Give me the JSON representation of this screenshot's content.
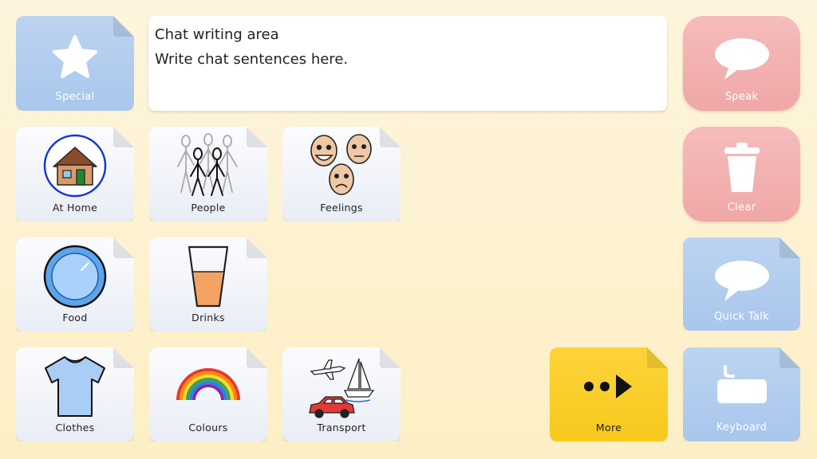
{
  "chat": {
    "line1": "Chat writing area",
    "line2": "Write chat sentences here."
  },
  "tiles": {
    "special": "Special",
    "speak": "Speak",
    "clear": "Clear",
    "quick_talk": "Quick Talk",
    "keyboard": "Keyboard",
    "more": "More",
    "at_home": "At Home",
    "people": "People",
    "feelings": "Feelings",
    "food": "Food",
    "drinks": "Drinks",
    "clothes": "Clothes",
    "colours": "Colours",
    "transport": "Transport"
  },
  "colors": {
    "background": "#fdf4dd",
    "folder_white": "#f1f4f9",
    "folder_blue": "#aec9ee",
    "action_pink": "#f3b1b1",
    "more_yellow": "#f9cd25"
  },
  "icons": {
    "special": "star-icon",
    "speak": "speech-bubble-icon",
    "clear": "trash-icon",
    "quick_talk": "speech-bubble-icon",
    "keyboard": "keyboard-icon",
    "more": "more-arrow-icon",
    "at_home": "house-icon",
    "people": "people-icon",
    "feelings": "faces-icon",
    "food": "plate-icon",
    "drinks": "glass-icon",
    "clothes": "tshirt-icon",
    "colours": "rainbow-icon",
    "transport": "transport-icon"
  }
}
